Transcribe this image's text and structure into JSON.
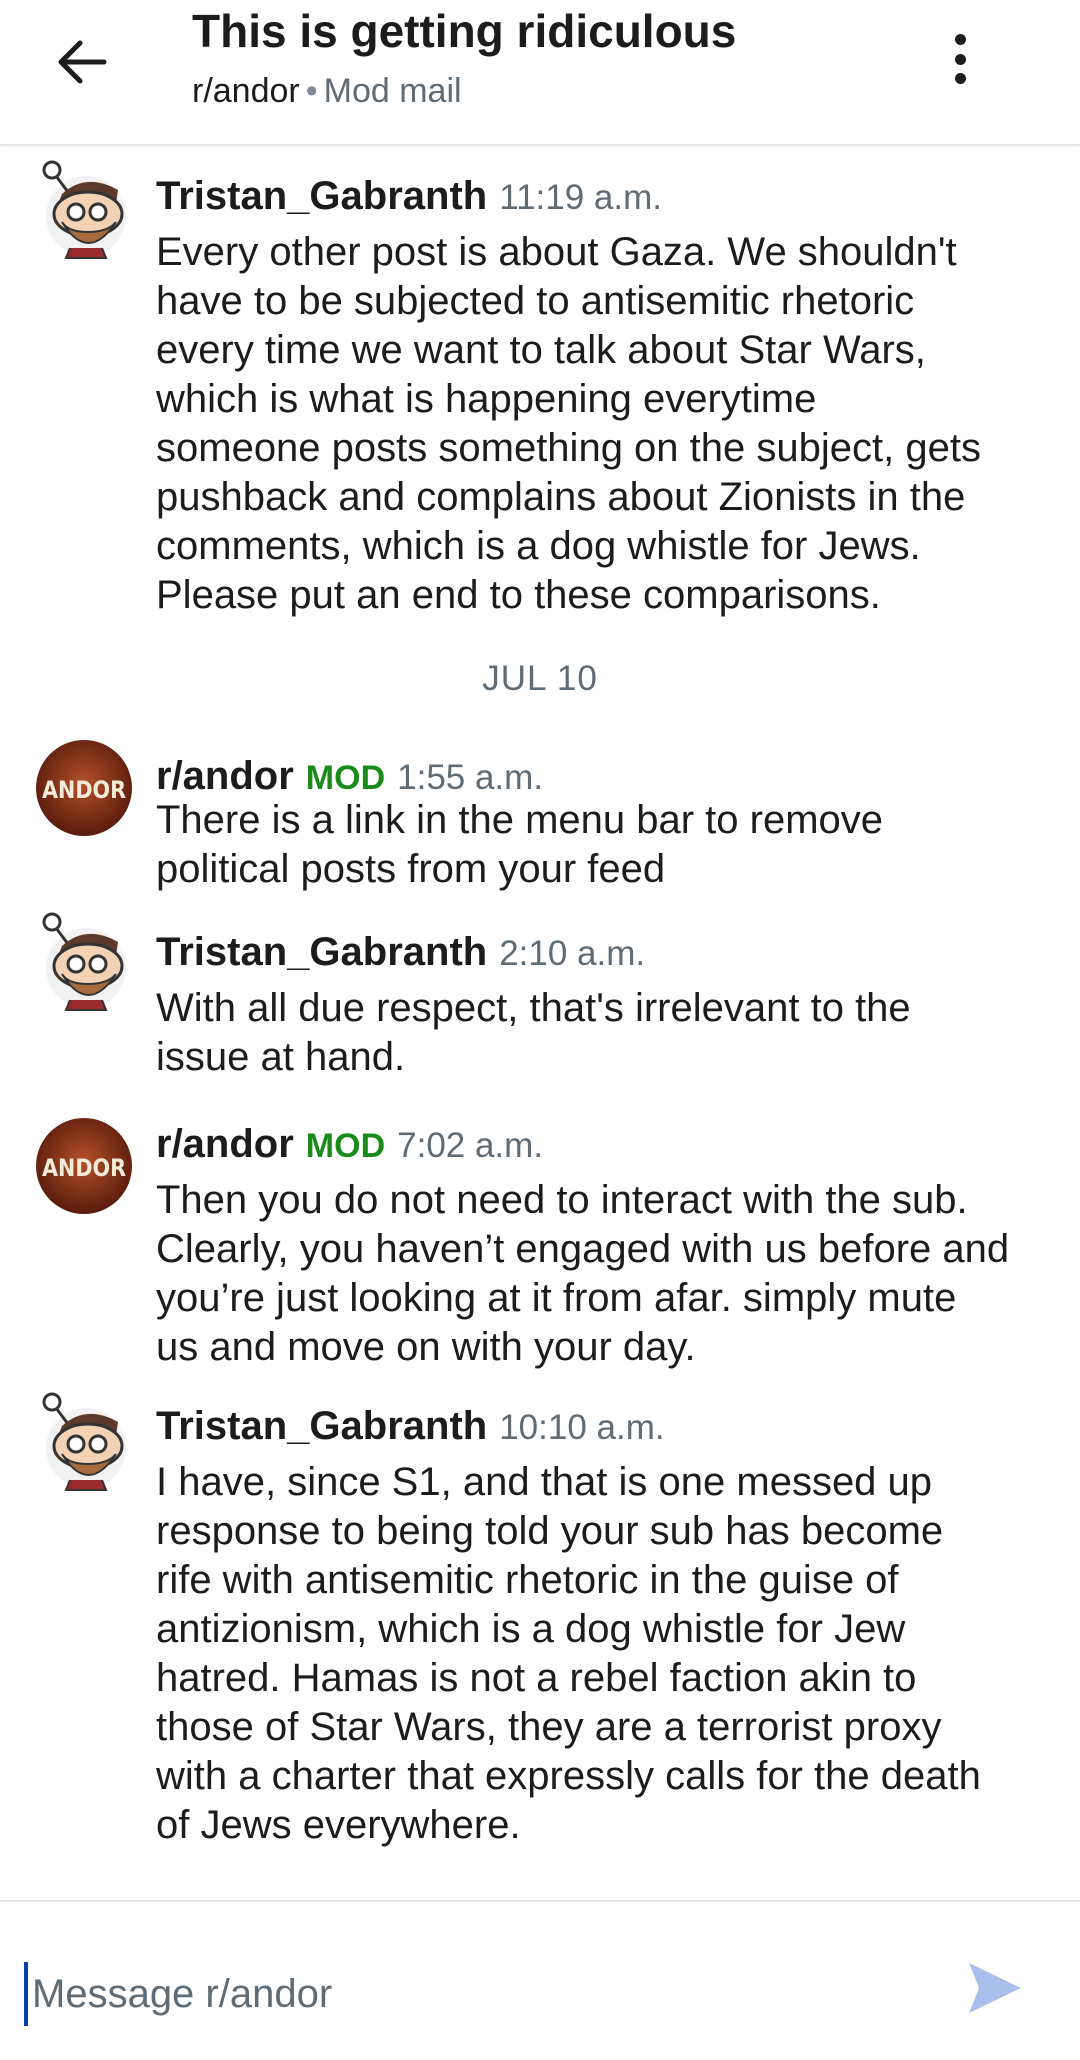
{
  "header": {
    "title": "This is getting ridiculous",
    "subreddit": "r/andor",
    "separator": "•",
    "kind": "Mod mail"
  },
  "messages": [
    {
      "author": "Tristan_Gabranth",
      "is_mod": false,
      "time": "11:19 a.m.",
      "lines": [
        "Every other post is about Gaza. We shouldn't",
        "have to be subjected to antisemitic rhetoric",
        "every time we want to talk about Star Wars,",
        "which is what is happening everytime",
        "someone posts something on the subject, gets",
        "pushback and complains about Zionists in the",
        "comments, which is a dog whistle for Jews.",
        "Please put an end to these comparisons."
      ]
    },
    {
      "author": "r/andor",
      "is_mod": true,
      "mod_label": "MOD",
      "time": "1:55 a.m.",
      "lines": [
        "There is a link in the menu bar to remove",
        "political posts from your feed"
      ]
    },
    {
      "author": "Tristan_Gabranth",
      "is_mod": false,
      "time": "2:10 a.m.",
      "lines": [
        "With all due respect, that's irrelevant to the",
        "issue at hand."
      ]
    },
    {
      "author": "r/andor",
      "is_mod": true,
      "mod_label": "MOD",
      "time": "7:02 a.m.",
      "lines": [
        "Then you do not need to interact with the sub.",
        "Clearly, you haven’t engaged with us before and",
        "you’re just looking at it from afar. simply mute",
        "us and move on with your day."
      ]
    },
    {
      "author": "Tristan_Gabranth",
      "is_mod": false,
      "time": "10:10 a.m.",
      "lines": [
        "I have, since S1, and that is one messed up",
        "response to being told your sub has become",
        "rife with antisemitic rhetoric in the guise of",
        "antizionism, which is a dog whistle for Jew",
        "hatred. Hamas is not a rebel faction akin to",
        "those of Star Wars, they are a terrorist proxy",
        "with a charter that expressly calls for the death",
        "of Jews everywhere."
      ]
    }
  ],
  "date_divider": "JUL 10",
  "subreddit_avatar_text": "ANDOR",
  "composer": {
    "placeholder": "Message r/andor"
  },
  "colors": {
    "mod_green": "#1a8b1a",
    "send_icon": "#a9c0ea",
    "andor_avatar_bg": "#7a2a14"
  }
}
